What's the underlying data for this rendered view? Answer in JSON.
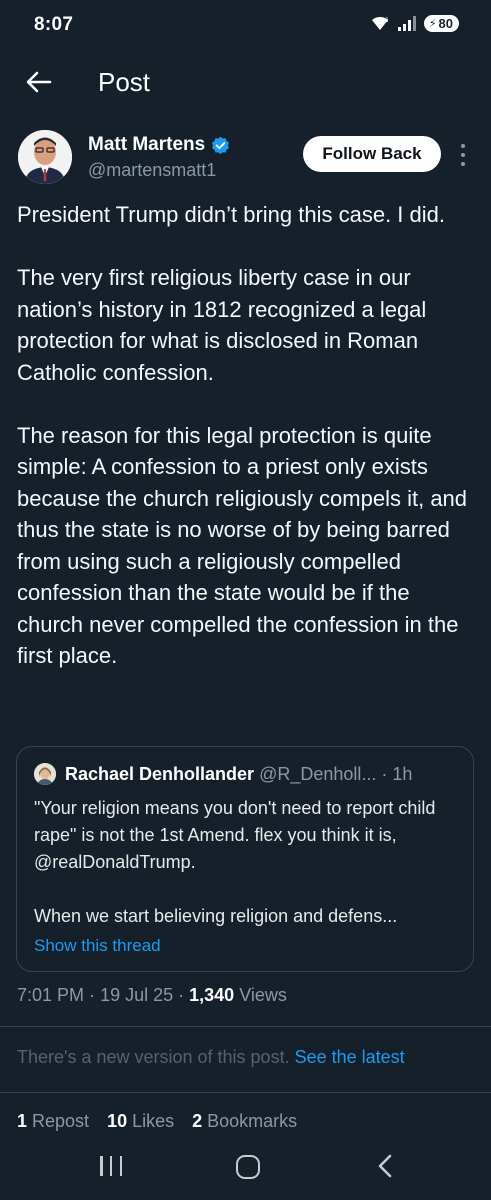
{
  "status": {
    "time": "8:07",
    "battery": "80"
  },
  "header": {
    "title": "Post"
  },
  "author": {
    "name": "Matt Martens",
    "handle": "@martensmatt1",
    "follow_label": "Follow Back"
  },
  "post": {
    "paragraphs": [
      "President Trump didn’t bring this case. I did.",
      "The very first religious liberty case in our nation’s history in 1812 recognized a legal protection for what is disclosed in Roman Catholic confession.",
      "The reason for this legal protection is quite simple: A confession to a priest only exists because the church religiously compels it, and thus the state is no worse of by being barred from using such a religiously compelled confession than the state would be if the church never compelled the confession in the first place."
    ]
  },
  "quote": {
    "name": "Rachael Denhollander",
    "handle": "@R_Denholl...",
    "time": "· 1h",
    "body": [
      "\"Your religion means you don't need to report child rape\" is not the 1st Amend. flex you think it is, @realDonaldTrump.",
      "When we start believing religion and defens..."
    ],
    "thread_link": "Show this thread"
  },
  "meta": {
    "time": "7:01 PM",
    "date": "19 Jul 25",
    "views_count": "1,340",
    "views_label": "Views"
  },
  "notice": {
    "text": "There's a new version of this post.",
    "link": "See the latest"
  },
  "stats": {
    "reposts_count": "1",
    "reposts_label": "Repost",
    "likes_count": "10",
    "likes_label": "Likes",
    "bookmarks_count": "2",
    "bookmarks_label": "Bookmarks"
  },
  "icons": {
    "back": "arrow-left-icon",
    "verified": "verified-badge-icon",
    "more": "more-vertical-icon",
    "nav_recent": "recent-apps-icon",
    "nav_home": "home-icon",
    "nav_back": "nav-back-icon"
  },
  "colors": {
    "background": "#15202b",
    "accent": "#1d9bf0",
    "muted": "#8b98a5",
    "border": "#38444d"
  }
}
